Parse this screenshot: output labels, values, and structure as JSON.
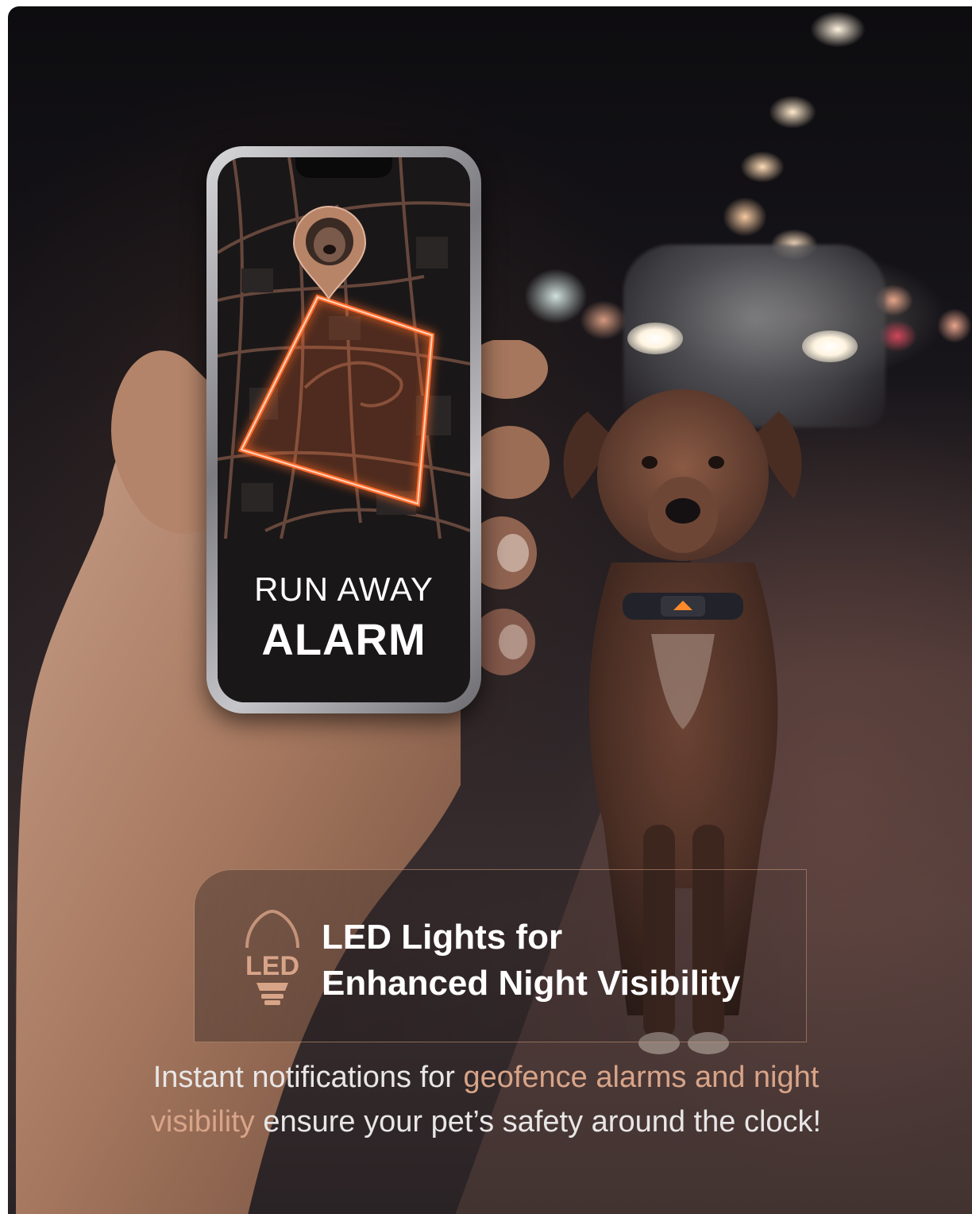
{
  "phone_screen": {
    "alarm_line1": "RUN AWAY",
    "alarm_line2": "ALARM"
  },
  "feature": {
    "icon_text": "LED",
    "icon": "led-bulb-icon",
    "title_line1": "LED Lights for",
    "title_line2": "Enhanced Night Visibility"
  },
  "caption": {
    "part1": "Instant notifications for ",
    "highlight1": "geofence alarms and night",
    "highlight2": "visibility",
    "part2": " ensure your pet’s safety around the clock!"
  },
  "colors": {
    "accent": "#d8a488",
    "geofence": "#ff6a2a",
    "background": "#17151a"
  }
}
